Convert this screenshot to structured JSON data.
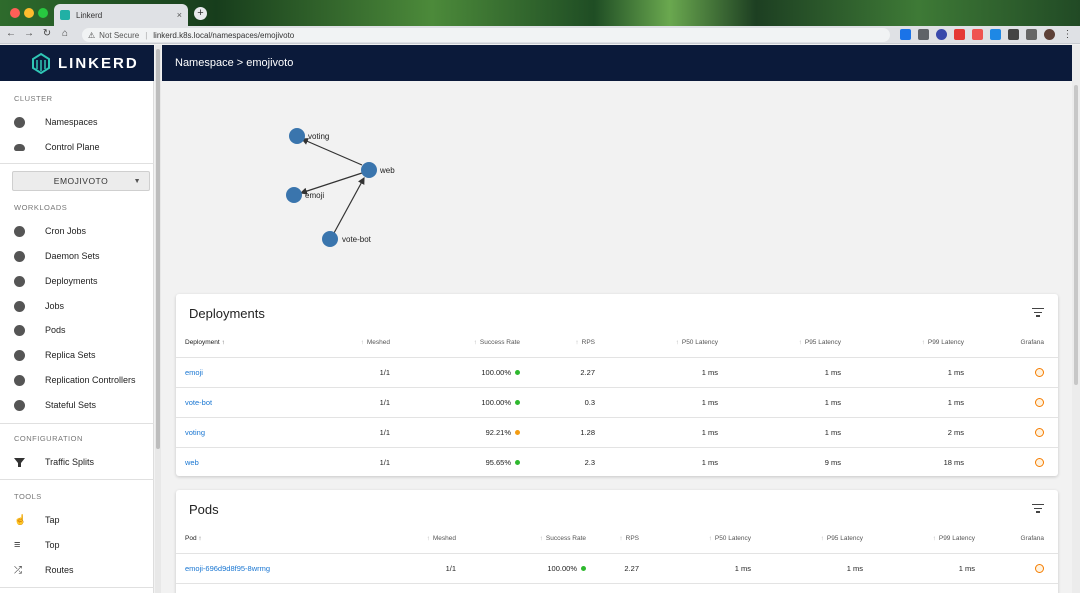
{
  "browser": {
    "tab_title": "Linkerd",
    "tab_close": "×",
    "new_tab": "+",
    "security_label": "Not Secure",
    "url": "linkerd.k8s.local/namespaces/emojivoto",
    "back": "←",
    "forward": "→",
    "reload": "↻",
    "home": "⌂"
  },
  "app": {
    "brand": "LINKERD",
    "header_title": "Namespace > emojivoto"
  },
  "sidebar": {
    "cluster_label": "CLUSTER",
    "cluster_items": [
      {
        "label": "Namespaces",
        "icon": "namespaces-icon"
      },
      {
        "label": "Control Plane",
        "icon": "cloud-icon"
      }
    ],
    "namespace_select": "EMOJIVOTO",
    "workloads_label": "WORKLOADS",
    "workload_items": [
      {
        "label": "Cron Jobs",
        "icon": "cron-jobs-icon"
      },
      {
        "label": "Daemon Sets",
        "icon": "daemon-sets-icon"
      },
      {
        "label": "Deployments",
        "icon": "deployments-icon"
      },
      {
        "label": "Jobs",
        "icon": "jobs-icon"
      },
      {
        "label": "Pods",
        "icon": "pods-icon"
      },
      {
        "label": "Replica Sets",
        "icon": "replica-sets-icon"
      },
      {
        "label": "Replication Controllers",
        "icon": "replication-controllers-icon"
      },
      {
        "label": "Stateful Sets",
        "icon": "stateful-sets-icon"
      }
    ],
    "configuration_label": "CONFIGURATION",
    "configuration_items": [
      {
        "label": "Traffic Splits",
        "icon": "filter-icon"
      }
    ],
    "tools_label": "TOOLS",
    "tools_items": [
      {
        "label": "Tap",
        "icon": "tap-icon"
      },
      {
        "label": "Top",
        "icon": "top-icon"
      },
      {
        "label": "Routes",
        "icon": "shuffle-icon"
      }
    ]
  },
  "graph": {
    "nodes": [
      "voting",
      "web",
      "emoji",
      "vote-bot"
    ],
    "node_color": "#3a75ad"
  },
  "deployments": {
    "title": "Deployments",
    "columns": [
      "Deployment",
      "Meshed",
      "Success Rate",
      "RPS",
      "P50 Latency",
      "P95 Latency",
      "P99 Latency",
      "Grafana"
    ],
    "rows": [
      {
        "name": "emoji",
        "meshed": "1/1",
        "success": "100.00%",
        "status": "green",
        "rps": "2.27",
        "p50": "1 ms",
        "p95": "1 ms",
        "p99": "1 ms"
      },
      {
        "name": "vote-bot",
        "meshed": "1/1",
        "success": "100.00%",
        "status": "green",
        "rps": "0.3",
        "p50": "1 ms",
        "p95": "1 ms",
        "p99": "1 ms"
      },
      {
        "name": "voting",
        "meshed": "1/1",
        "success": "92.21%",
        "status": "orange",
        "rps": "1.28",
        "p50": "1 ms",
        "p95": "1 ms",
        "p99": "2 ms"
      },
      {
        "name": "web",
        "meshed": "1/1",
        "success": "95.65%",
        "status": "green",
        "rps": "2.3",
        "p50": "1 ms",
        "p95": "9 ms",
        "p99": "18 ms"
      }
    ]
  },
  "pods": {
    "title": "Pods",
    "columns": [
      "Pod",
      "Meshed",
      "Success Rate",
      "RPS",
      "P50 Latency",
      "P95 Latency",
      "P99 Latency",
      "Grafana"
    ],
    "rows": [
      {
        "name": "emoji-696d9d8f95-8wrmg",
        "meshed": "1/1",
        "success": "100.00%",
        "status": "green",
        "rps": "2.27",
        "p50": "1 ms",
        "p95": "1 ms",
        "p99": "1 ms"
      }
    ]
  },
  "colors": {
    "navy": "#0b1a3a",
    "link": "#1976d2",
    "status_green": "#2eb82e",
    "status_orange": "#f39c12",
    "grafana_orange": "#f57c00"
  }
}
